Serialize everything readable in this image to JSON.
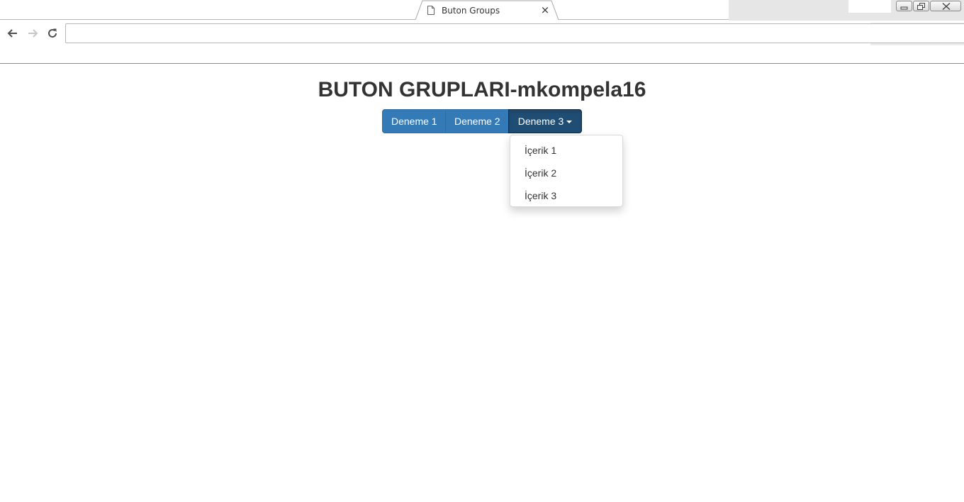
{
  "browser": {
    "tab": {
      "title": "Buton Groups",
      "close_glyph": "×",
      "icon": "document-icon"
    },
    "window_controls": [
      "minimize-icon",
      "restore-icon",
      "close-icon"
    ],
    "nav": [
      "back-arrow-icon",
      "forward-arrow-icon",
      "reload-icon"
    ],
    "address": {
      "value": ""
    }
  },
  "page": {
    "title": "BUTON GRUPLARI-mkompela16",
    "buttons": [
      {
        "label": "Deneme 1"
      },
      {
        "label": "Deneme 2"
      },
      {
        "label": "Deneme 3",
        "has_caret": true,
        "state": "open"
      }
    ],
    "dropdown": {
      "items": [
        {
          "label": "İçerik 1"
        },
        {
          "label": "İçerik 2"
        },
        {
          "label": "İçerik 3"
        }
      ]
    },
    "colors": {
      "primary": "#337ab7",
      "primary_active": "#204d74",
      "text": "#333333"
    }
  }
}
